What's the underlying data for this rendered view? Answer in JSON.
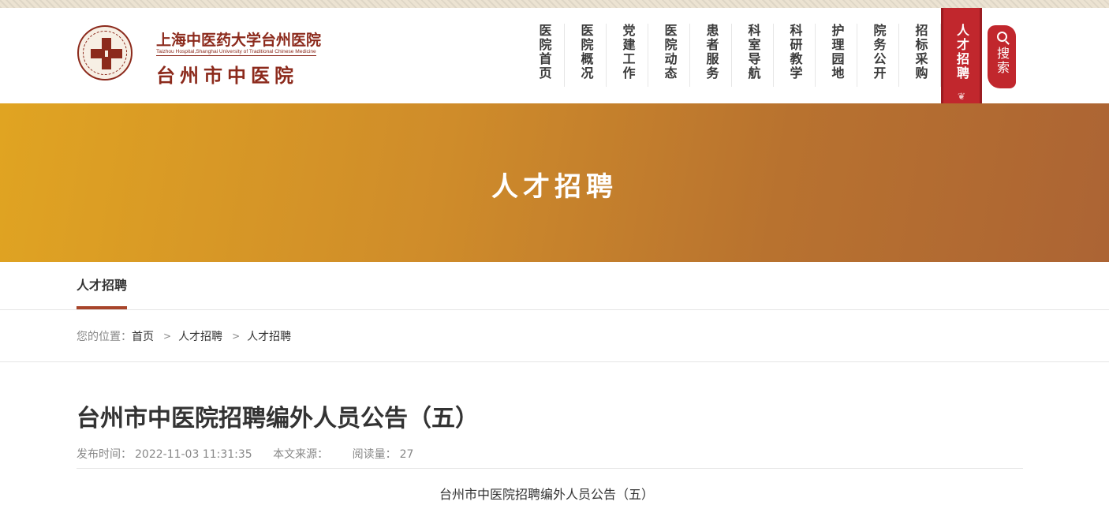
{
  "site": {
    "name_line1": "上海中医药大学台州医院",
    "name_en": "Taizhou Hospital,Shanghai University of Traditional Chinese Medicine",
    "name_line2": "台州市中医院"
  },
  "nav": {
    "items": [
      {
        "label": "医院首页",
        "active": false
      },
      {
        "label": "医院概况",
        "active": false
      },
      {
        "label": "党建工作",
        "active": false
      },
      {
        "label": "医院动态",
        "active": false
      },
      {
        "label": "患者服务",
        "active": false
      },
      {
        "label": "科室导航",
        "active": false
      },
      {
        "label": "科研教学",
        "active": false
      },
      {
        "label": "护理园地",
        "active": false
      },
      {
        "label": "院务公开",
        "active": false
      },
      {
        "label": "招标采购",
        "active": false
      },
      {
        "label": "人才招聘",
        "active": true
      }
    ],
    "search_label": "搜索",
    "accent": "#c1272d"
  },
  "banner": {
    "title": "人才招聘"
  },
  "subnav": {
    "active_tab": "人才招聘"
  },
  "breadcrumb": {
    "prefix": "您的位置：",
    "items": [
      "首页",
      "人才招聘",
      "人才招聘"
    ]
  },
  "article": {
    "title": "台州市中医院招聘编外人员公告（五）",
    "publish_label": "发布时间：",
    "publish_time": "2022-11-03 11:31:35",
    "source_label": "本文来源：",
    "source": "",
    "views_label": "阅读量：",
    "views": "27",
    "first_line": "台州市中医院招聘编外人员公告（五）"
  }
}
